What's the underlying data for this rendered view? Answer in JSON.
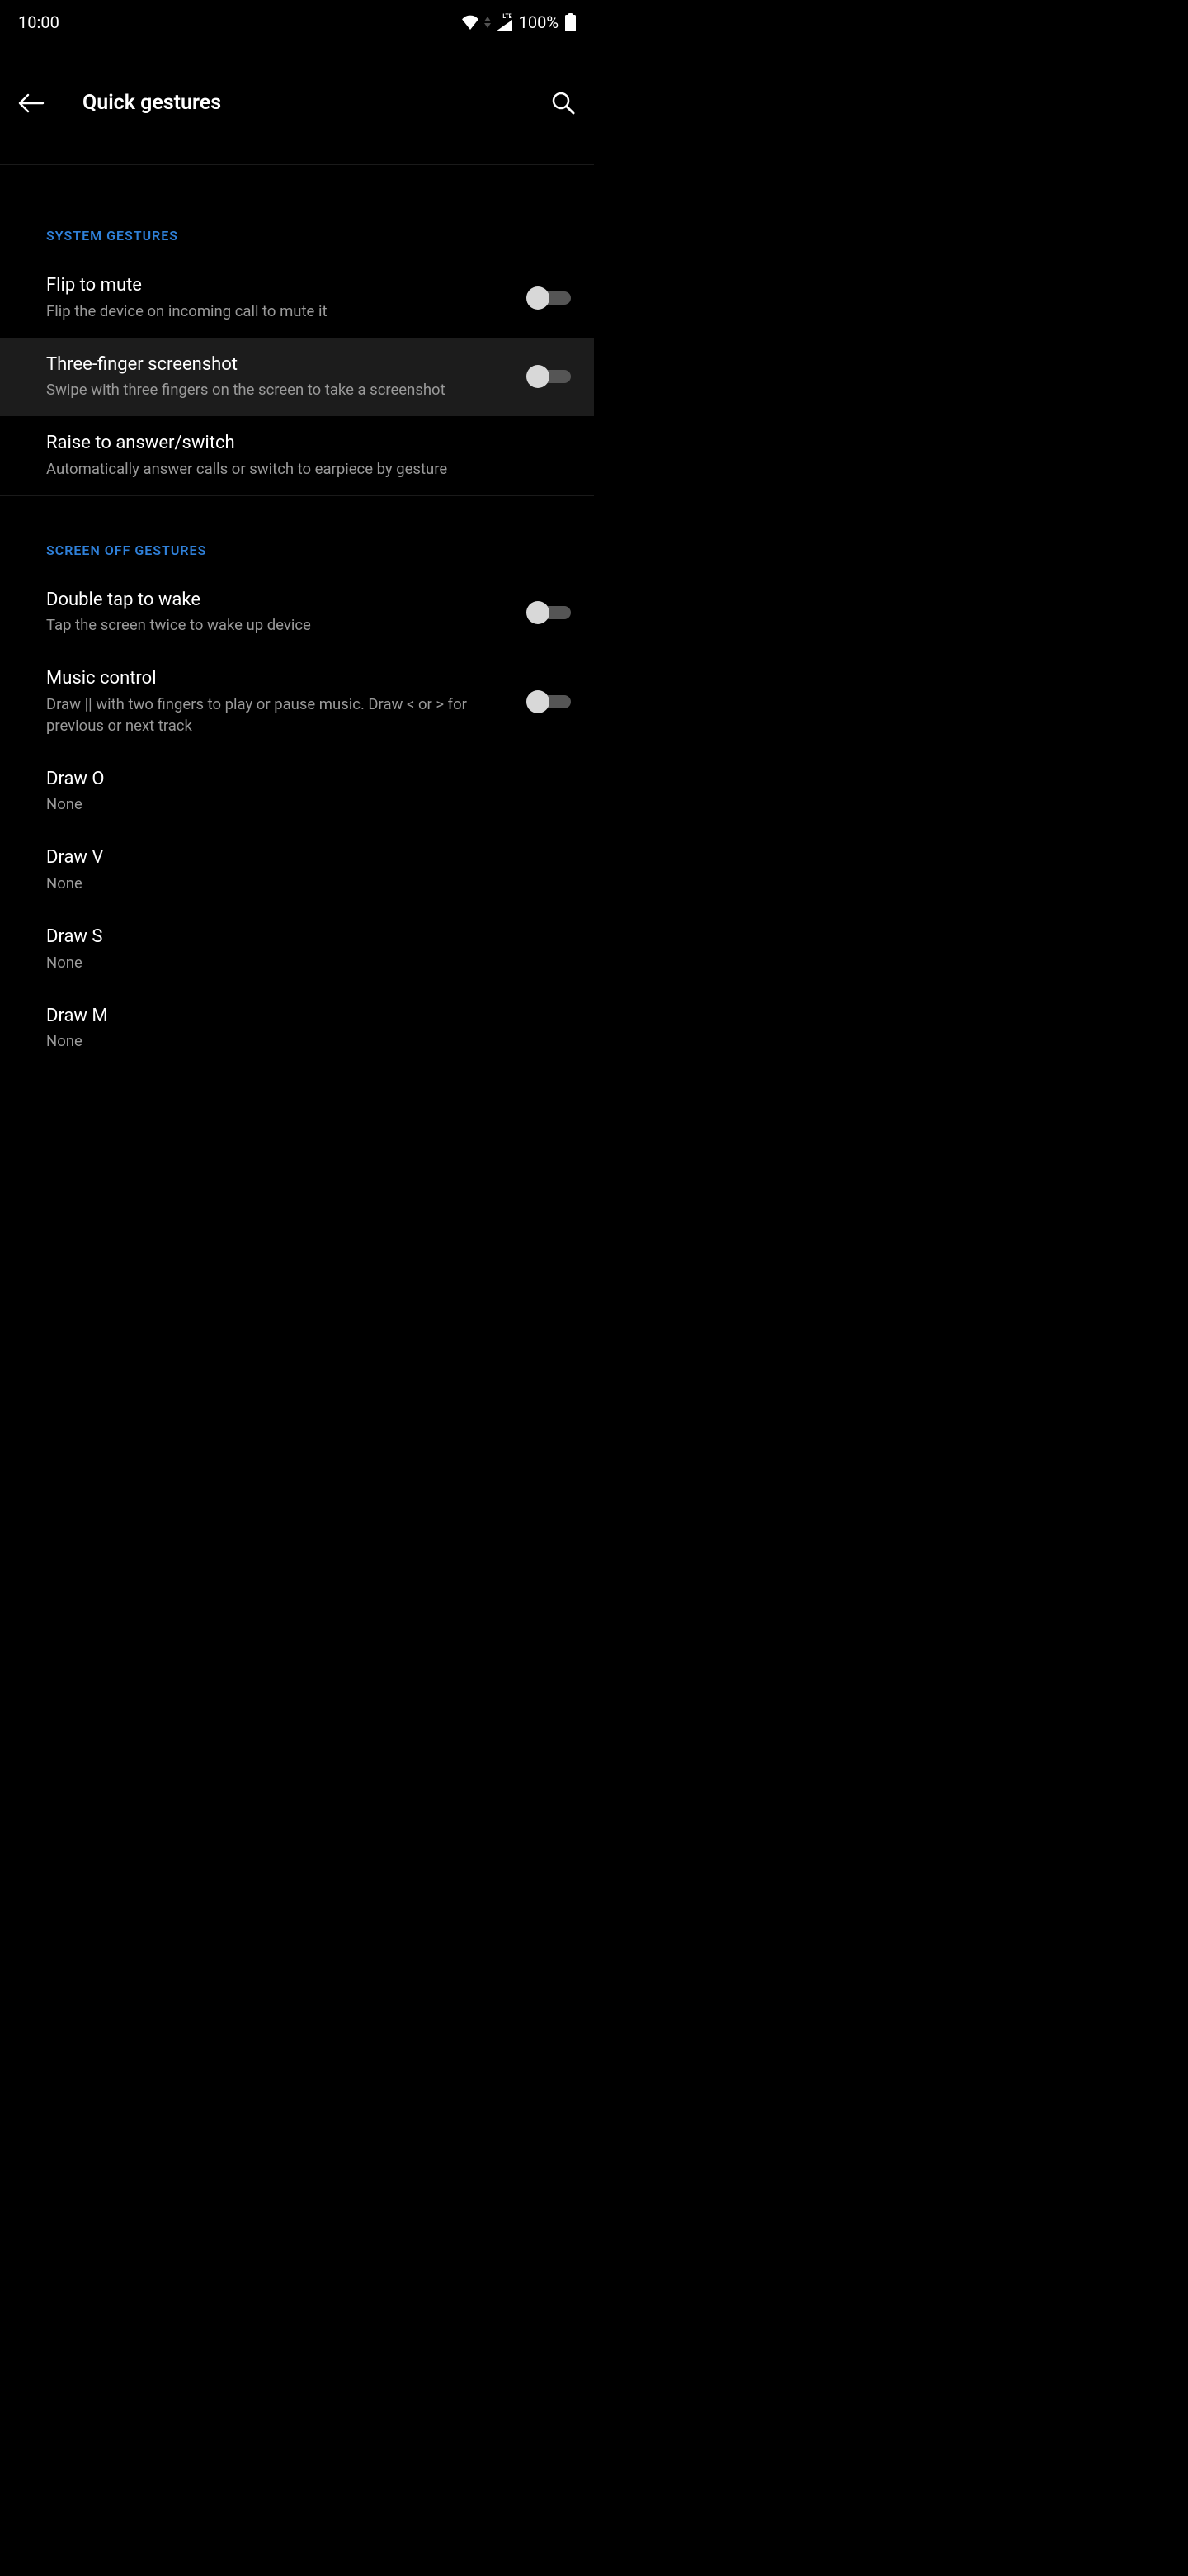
{
  "status": {
    "time": "10:00",
    "battery": "100%"
  },
  "header": {
    "title": "Quick gestures"
  },
  "sections": {
    "system": {
      "label": "SYSTEM GESTURES",
      "flip": {
        "title": "Flip to mute",
        "sub": "Flip the device on incoming call to mute it"
      },
      "three_finger": {
        "title": "Three-finger screenshot",
        "sub": "Swipe with three fingers on the screen to take a screenshot"
      },
      "raise": {
        "title": "Raise to answer/switch",
        "sub": "Automatically answer calls or switch to earpiece by gesture"
      }
    },
    "screen_off": {
      "label": "SCREEN OFF GESTURES",
      "double_tap": {
        "title": "Double tap to wake",
        "sub": "Tap the screen twice to wake up device"
      },
      "music": {
        "title": "Music control",
        "sub": "Draw || with two fingers to play or pause music. Draw < or > for previous or next track"
      },
      "draw_o": {
        "title": "Draw O",
        "sub": "None"
      },
      "draw_v": {
        "title": "Draw V",
        "sub": "None"
      },
      "draw_s": {
        "title": "Draw S",
        "sub": "None"
      },
      "draw_m": {
        "title": "Draw M",
        "sub": "None"
      }
    }
  }
}
